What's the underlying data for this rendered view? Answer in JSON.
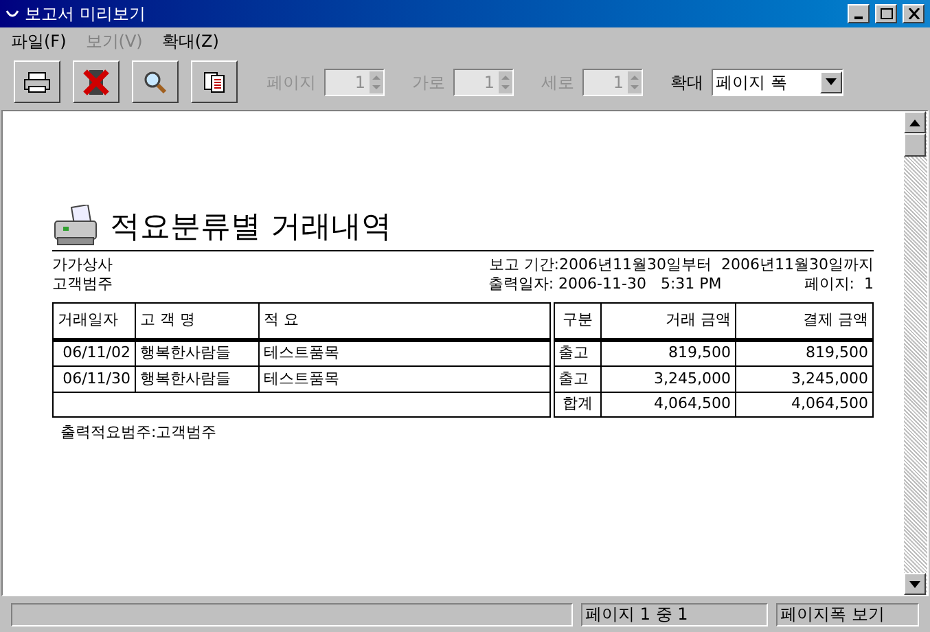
{
  "window": {
    "title": "보고서 미리보기"
  },
  "menu": [
    {
      "label": "파일(F)",
      "disabled": false
    },
    {
      "label": "보기(V)",
      "disabled": true
    },
    {
      "label": "확대(Z)",
      "disabled": false
    }
  ],
  "toolbar": {
    "buttons": [
      {
        "kind": "print"
      },
      {
        "kind": "close"
      },
      {
        "kind": "zoom"
      },
      {
        "kind": "pages"
      }
    ],
    "spinners": [
      {
        "label": "페이지",
        "value": "1",
        "disabled": true
      },
      {
        "label": "가로",
        "value": "1",
        "disabled": true
      },
      {
        "label": "세로",
        "value": "1",
        "disabled": true
      }
    ],
    "zoom": {
      "label": "확대",
      "value": "페이지 폭"
    }
  },
  "report": {
    "title": "적요분류별 거래내역",
    "company": "가가상사",
    "category": "고객범주",
    "period": "보고 기간:2006년11월30일부터  2006년11월30일까지",
    "printed_at": "출력일자: 2006-11-30   5:31 PM",
    "page": "페이지:  1",
    "columns": [
      "거래일자",
      "고 객 명",
      "적 요",
      "구분",
      "거래 금액",
      "결제 금액"
    ],
    "rows": [
      {
        "cells": [
          "06/11/02",
          "행복한사람들",
          "테스트품목",
          "출고",
          "819,500",
          "819,500"
        ]
      },
      {
        "cells": [
          "06/11/30",
          "행복한사람들",
          "테스트품목",
          "출고",
          "3,245,000",
          "3,245,000"
        ]
      }
    ],
    "total": {
      "label": "합계",
      "amount": "4,064,500",
      "settled": "4,064,500"
    },
    "footer": "출력적요범주:고객범주"
  },
  "status_bar": [
    "페이지 1 중 1",
    "페이지폭 보기"
  ]
}
